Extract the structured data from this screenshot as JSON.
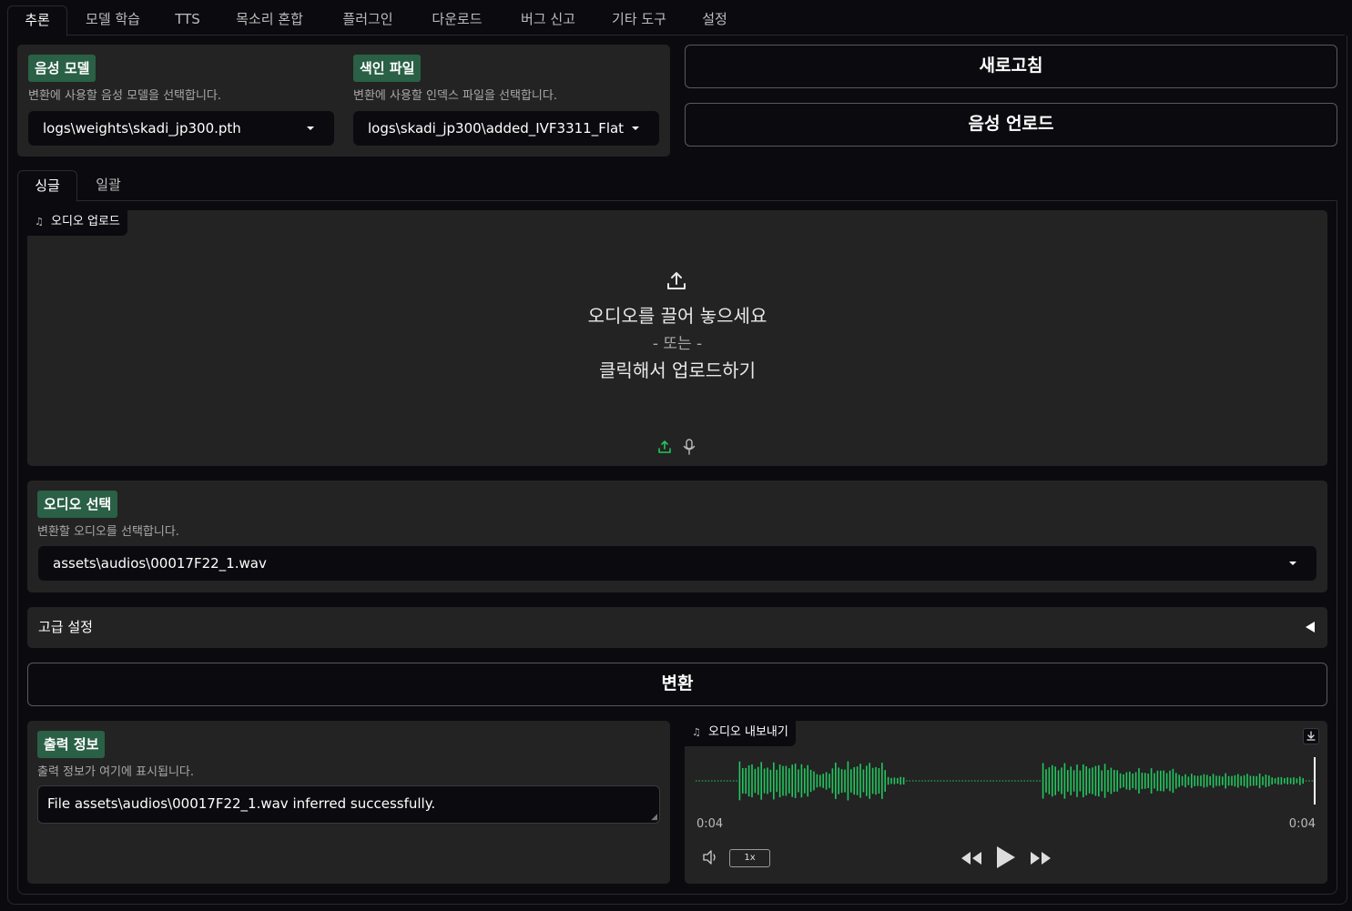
{
  "top_tabs": [
    "추론",
    "모델 학습",
    "TTS",
    "목소리 혼합",
    "플러그인",
    "다운로드",
    "버그 신고",
    "기타 도구",
    "설정"
  ],
  "voice_model": {
    "tag": "음성 모델",
    "description": "변환에 사용할 음성 모델을 선택합니다.",
    "value": "logs\\weights\\skadi_jp300.pth"
  },
  "index_file": {
    "tag": "색인 파일",
    "description": "변환에 사용할 인덱스 파일을 선택합니다.",
    "value": "logs\\skadi_jp300\\added_IVF3311_Flat"
  },
  "buttons": {
    "refresh": "새로고침",
    "upload_voice": "음성 언로드",
    "convert": "변환"
  },
  "sub_tabs": [
    "싱글",
    "일괄"
  ],
  "audio_upload": {
    "label": "오디오 업로드",
    "drop_line1": "오디오를 끌어 놓으세요",
    "drop_line2": "- 또는 -",
    "drop_line3": "클릭해서 업로드하기"
  },
  "audio_select": {
    "tag": "오디오 선택",
    "description": "변환할 오디오를 선택합니다.",
    "value": "assets\\audios\\00017F22_1.wav"
  },
  "advanced": {
    "label": "고급 설정"
  },
  "output_info": {
    "tag": "출력 정보",
    "description": "출력 정보가 여기에 표시됩니다.",
    "value": "File assets\\audios\\00017F22_1.wav inferred successfully."
  },
  "audio_export": {
    "label": "오디오 내보내기",
    "time_current": "0:04",
    "time_total": "0:04",
    "speed": "1x",
    "wave_color": "#22c55e"
  },
  "colors": {
    "accent": "#2a6046",
    "panel": "#232323",
    "background": "#0b0b0f"
  }
}
